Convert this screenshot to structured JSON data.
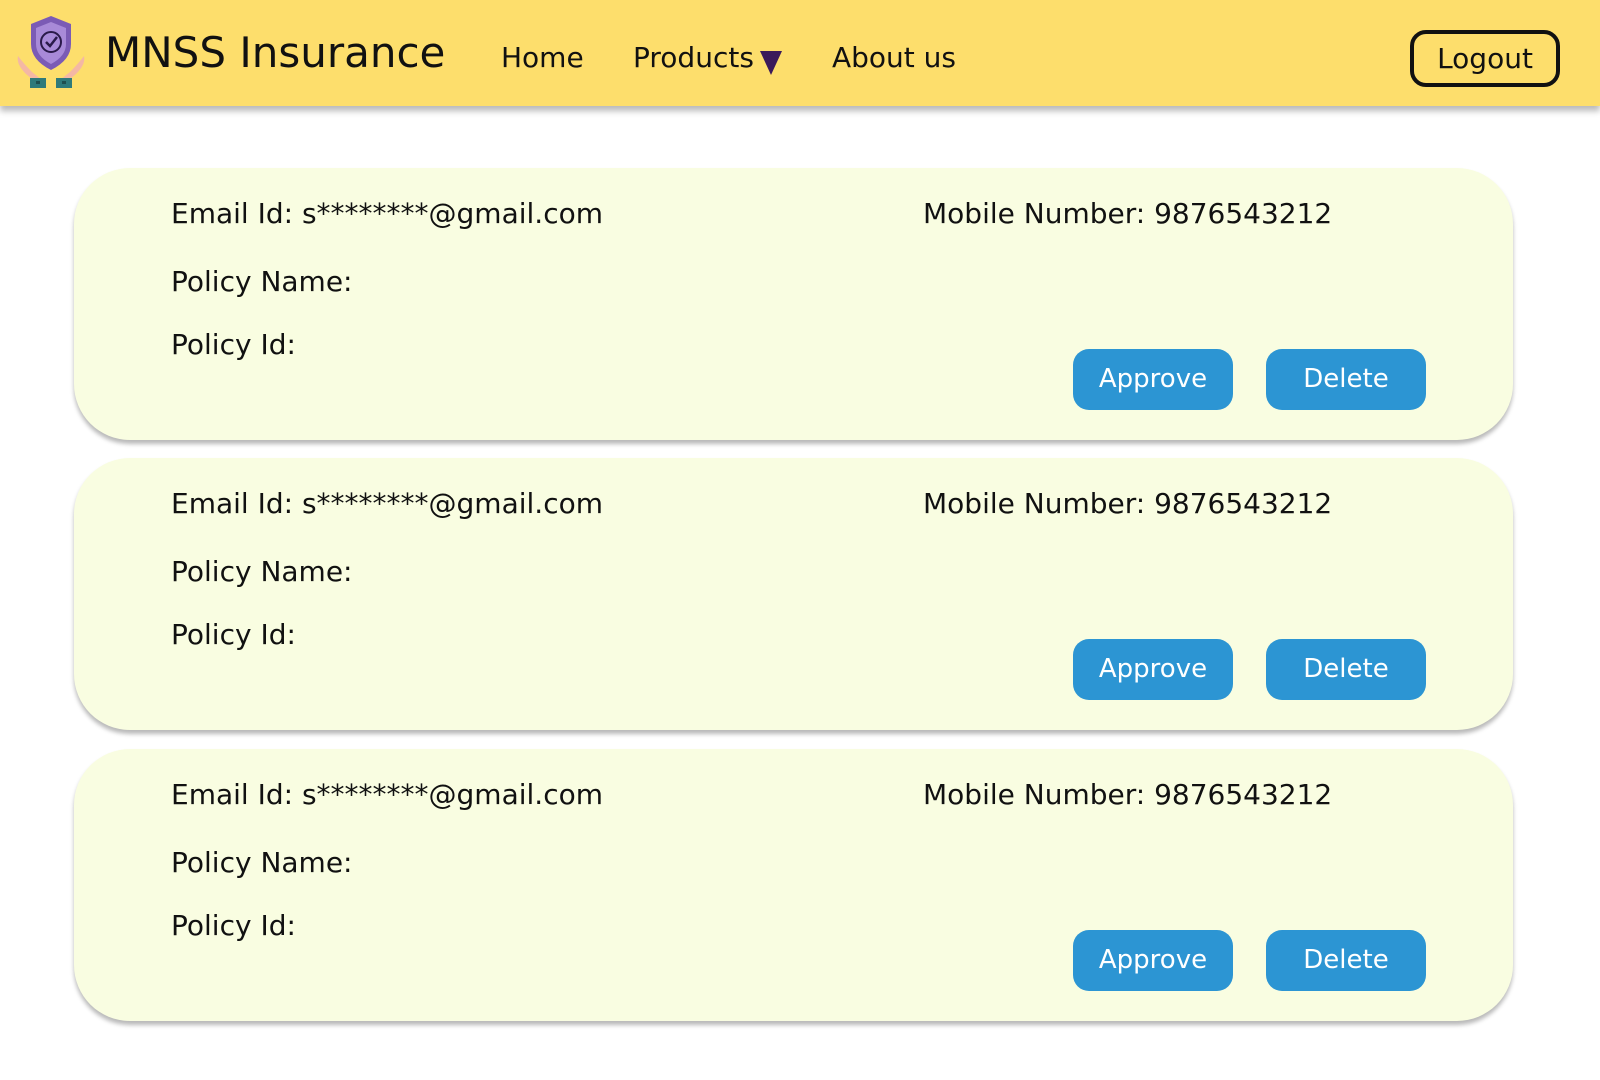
{
  "app": {
    "brand": "MNSS Insurance",
    "logo_icon": "shield-hands-icon"
  },
  "nav": {
    "home": "Home",
    "products": "Products",
    "about": "About us",
    "logout": "Logout"
  },
  "colors": {
    "navbar": "#fdde6c",
    "card_bg": "#f9fde1",
    "button_bg": "#2c95d3",
    "caret": "#3b1a5a"
  },
  "requests": [
    {
      "email_label": "Email Id: s********@gmail.com",
      "mobile_label": "Mobile Number: 9876543212",
      "policy_name_label": "Policy Name:",
      "policy_id_label": "Policy Id:",
      "approve": "Approve",
      "delete": "Delete"
    },
    {
      "email_label": "Email Id: s********@gmail.com",
      "mobile_label": "Mobile Number: 9876543212",
      "policy_name_label": "Policy Name:",
      "policy_id_label": "Policy Id:",
      "approve": "Approve",
      "delete": "Delete"
    },
    {
      "email_label": "Email Id: s********@gmail.com",
      "mobile_label": "Mobile Number: 9876543212",
      "policy_name_label": "Policy Name:",
      "policy_id_label": "Policy Id:",
      "approve": "Approve",
      "delete": "Delete"
    }
  ]
}
